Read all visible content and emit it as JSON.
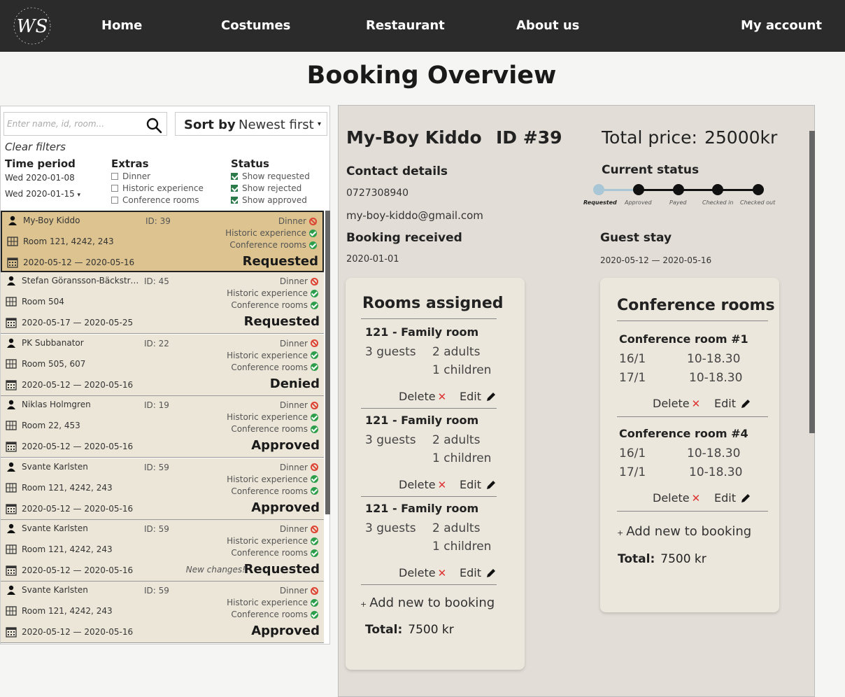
{
  "nav": {
    "logo": "WS",
    "links": [
      "Home",
      "Costumes",
      "Restaurant",
      "About us",
      "My account"
    ]
  },
  "page_title": "Booking Overview",
  "filters": {
    "search_placeholder": "Enter name, id, room...",
    "sort_label": "Sort by",
    "sort_value": "Newest first",
    "clear": "Clear filters",
    "time_period_label": "Time period",
    "date_from": "Wed 2020-01-08",
    "date_to": "Wed 2020-01-15",
    "extras_label": "Extras",
    "extras": [
      {
        "label": "Dinner",
        "checked": false
      },
      {
        "label": "Historic experience",
        "checked": false
      },
      {
        "label": "Conference rooms",
        "checked": false
      }
    ],
    "status_label": "Status",
    "status": [
      {
        "label": "Show requested",
        "checked": true
      },
      {
        "label": "Show rejected",
        "checked": true
      },
      {
        "label": "Show approved",
        "checked": true
      }
    ]
  },
  "bookings": [
    {
      "name": "My-Boy Kiddo",
      "id": "ID: 39",
      "room": "Room 121, 4242, 243",
      "dates": "2020-05-12 — 2020-05-16",
      "status": "Requested",
      "note": "",
      "selected": true
    },
    {
      "name": "Stefan Göransson-Bäckström",
      "id": "ID: 45",
      "room": "Room 504",
      "dates": "2020-05-17 — 2020-05-25",
      "status": "Requested",
      "note": "",
      "selected": false
    },
    {
      "name": "PK Subbanator",
      "id": "ID: 22",
      "room": "Room 505, 607",
      "dates": "2020-05-12 — 2020-05-16",
      "status": "Denied",
      "note": "",
      "selected": false
    },
    {
      "name": "Niklas Holmgren",
      "id": "ID: 19",
      "room": "Room 22, 453",
      "dates": "2020-05-12 — 2020-05-16",
      "status": "Approved",
      "note": "",
      "selected": false
    },
    {
      "name": "Svante Karlsten",
      "id": "ID: 59",
      "room": "Room 121, 4242, 243",
      "dates": "2020-05-12 — 2020-05-16",
      "status": "Approved",
      "note": "",
      "selected": false
    },
    {
      "name": "Svante Karlsten",
      "id": "ID: 59",
      "room": "Room 121, 4242, 243",
      "dates": "2020-05-12 — 2020-05-16",
      "status": "Requested",
      "note": "New changes!",
      "selected": false
    },
    {
      "name": "Svante Karlsten",
      "id": "ID: 59",
      "room": "Room 121, 4242, 243",
      "dates": "2020-05-12 — 2020-05-16",
      "status": "Approved",
      "note": "",
      "selected": false
    }
  ],
  "booking_extras": [
    "Dinner",
    "Historic experience",
    "Conference rooms"
  ],
  "detail": {
    "guest": "My-Boy Kiddo",
    "id": "ID #39",
    "total_price_label": "Total price:",
    "total_price": "25000kr",
    "contact_label": "Contact details",
    "phone": "0727308940",
    "email": "my-boy-kiddo@gmail.com",
    "received_label": "Booking received",
    "received": "2020-01-01",
    "status_label": "Current status",
    "status_steps": [
      "Requested",
      "Approved",
      "Payed",
      "Checked in",
      "Checked out"
    ],
    "stay_label": "Guest stay",
    "stay": "2020-05-12 — 2020-05-16",
    "rooms_title": "Rooms assigned",
    "rooms": [
      {
        "title": "121 - Family room",
        "guests": "3 guests",
        "adults": "2 adults",
        "children": "1 children"
      },
      {
        "title": "121 - Family room",
        "guests": "3 guests",
        "adults": "2 adults",
        "children": "1 children"
      },
      {
        "title": "121 - Family room",
        "guests": "3 guests",
        "adults": "2 adults",
        "children": "1 children"
      }
    ],
    "delete_label": "Delete",
    "edit_label": "Edit",
    "add_label": "Add new to booking",
    "total_label": "Total:",
    "rooms_total": "7500 kr",
    "conf_title": "Conference rooms",
    "conf": [
      {
        "title": "Conference room #1",
        "slots": [
          [
            "16/1",
            "10-18.30"
          ],
          [
            "17/1",
            "10-18.30"
          ]
        ]
      },
      {
        "title": "Conference room #4",
        "slots": [
          [
            "16/1",
            "10-18.30"
          ],
          [
            "17/1",
            "10-18.30"
          ]
        ]
      }
    ],
    "conf_total": "7500 kr"
  }
}
